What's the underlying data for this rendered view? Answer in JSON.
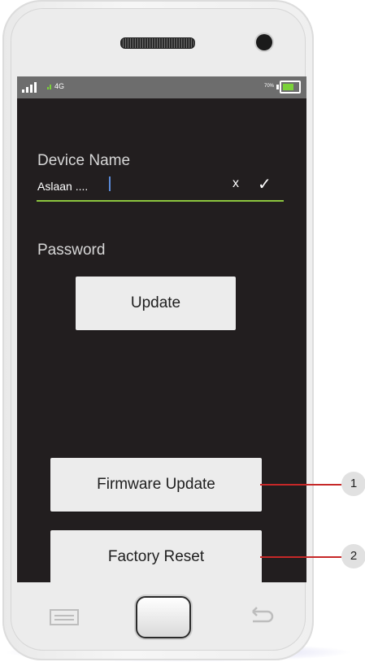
{
  "status_bar": {
    "network": "4G",
    "battery_percent": "70%",
    "battery_level": 0.7
  },
  "form": {
    "device_name_label": "Device Name",
    "device_name_value": "Aslaan ....",
    "clear_symbol": "x",
    "confirm_symbol": "✓",
    "password_label": "Password",
    "update_button": "Update"
  },
  "actions": {
    "firmware_update_button": "Firmware Update",
    "factory_reset_button": "Factory Reset"
  },
  "callouts": [
    "1",
    "2"
  ],
  "colors": {
    "screen_bg": "#221e1f",
    "status_bar_bg": "#6d6d6d",
    "accent_green": "#8cc63f",
    "battery_green": "#7bd23a",
    "callout_red": "#c62828",
    "button_bg": "#ececec"
  },
  "icons": {
    "signal": "signal-bars-icon",
    "battery": "battery-icon",
    "menu": "menu-icon",
    "home": "home-button",
    "back": "back-arrow-icon"
  }
}
